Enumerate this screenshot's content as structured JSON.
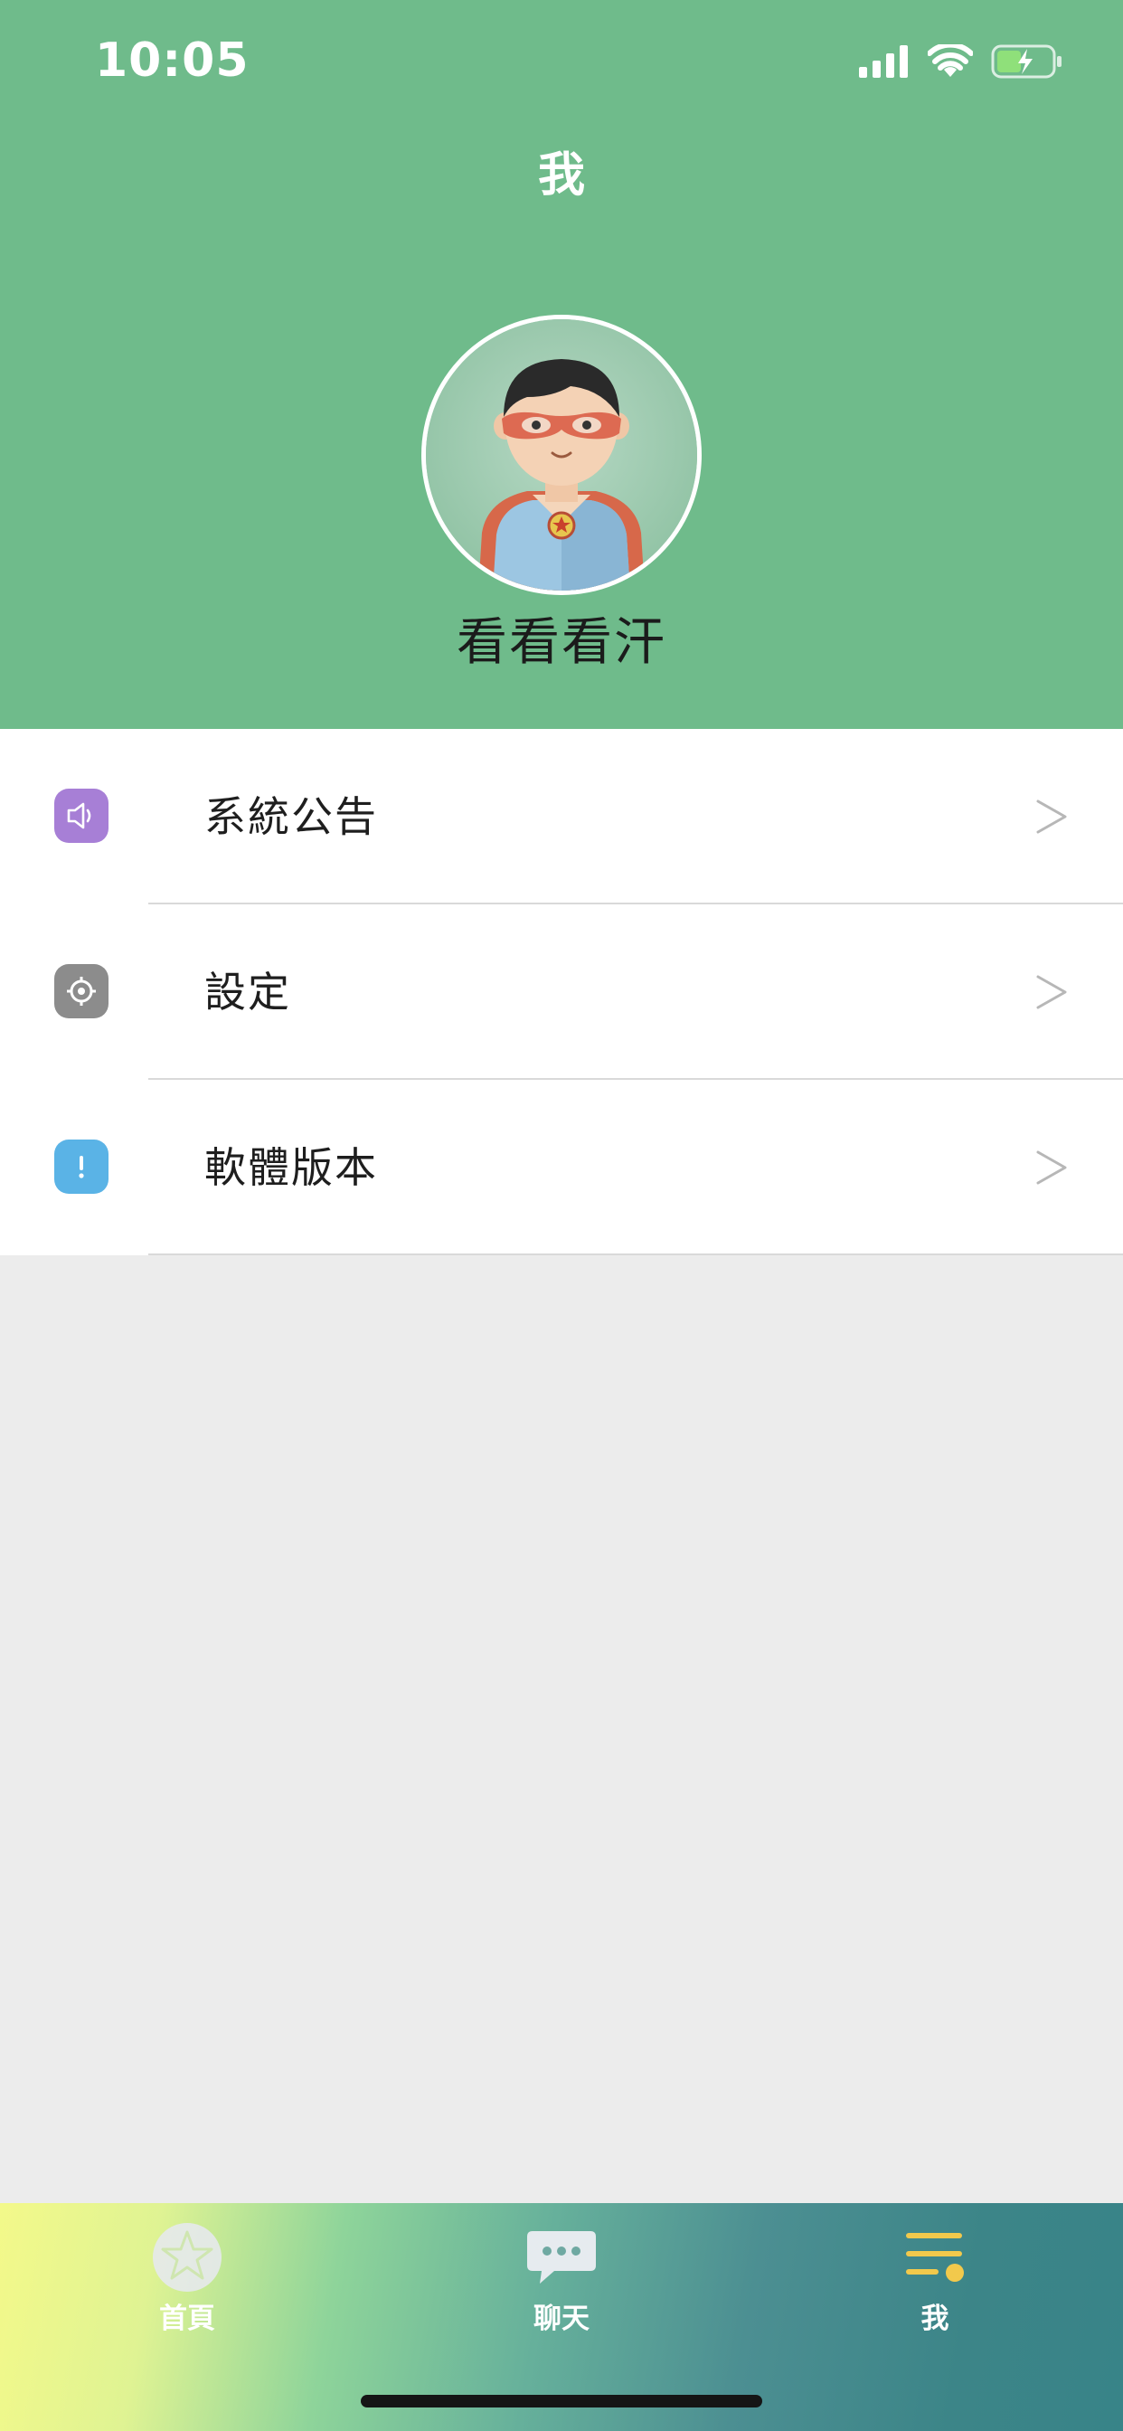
{
  "status_bar": {
    "time": "10:05",
    "icons": [
      "cellular-signal-icon",
      "wifi-icon",
      "battery-charging-icon"
    ]
  },
  "header": {
    "title": "我",
    "avatar_icon": "superhero-avatar",
    "username": "看看看汗",
    "background_color": "#6fbb8b"
  },
  "menu": {
    "items": [
      {
        "label": "系統公告",
        "icon": "speaker-icon",
        "icon_color": "#a77fd6",
        "chevron": ">"
      },
      {
        "label": "設定",
        "icon": "gear-icon",
        "icon_color": "#8c8c8c",
        "chevron": ">"
      },
      {
        "label": "軟體版本",
        "icon": "info-icon",
        "icon_color": "#5ab3e6",
        "chevron": ">"
      }
    ]
  },
  "tabbar": {
    "tabs": [
      {
        "label": "首頁",
        "icon": "star-icon",
        "active": false
      },
      {
        "label": "聊天",
        "icon": "chat-bubble-icon",
        "active": false
      },
      {
        "label": "我",
        "icon": "list-menu-icon",
        "active": true,
        "accent_color": "#f2c94c"
      }
    ]
  }
}
